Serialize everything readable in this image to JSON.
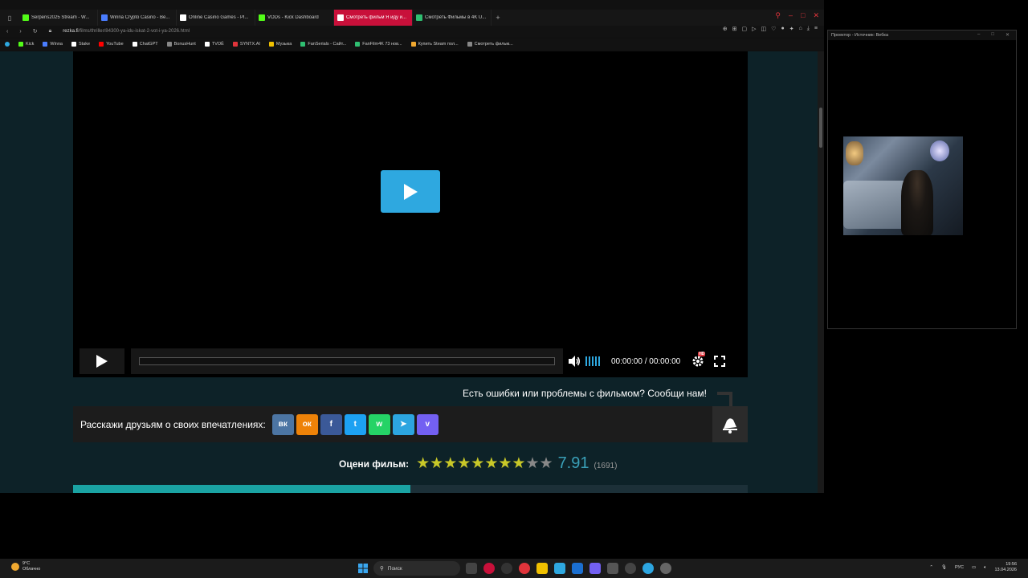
{
  "browser": {
    "tabs": [
      {
        "label": "Serpens2025 Stream - W...",
        "icon": "kick-icon",
        "color": "#53fc18"
      },
      {
        "label": "Winna Crypto Casino - Be...",
        "icon": "winna-icon",
        "color": "#4a7dff"
      },
      {
        "label": "Online Casino Games - Pl...",
        "icon": "stake-icon",
        "color": "#ffffff"
      },
      {
        "label": "VODs - Kick Dashboard",
        "icon": "kick-icon",
        "color": "#53fc18"
      },
      {
        "label": "Смотреть фильм Я иду и...",
        "icon": "hd-icon",
        "color": "#ffffff"
      },
      {
        "label": "Смотреть Фильмы в 4K U...",
        "icon": "fanfilm-icon",
        "color": "#2fbf71"
      }
    ],
    "url_host": "rezka.fi",
    "url_path": "/films/thriller/84300-ya-idu-iskat-2-vot-i-ya-2026.html",
    "bookmarks": [
      {
        "label": "Kick",
        "color": "#53fc18"
      },
      {
        "label": "Winna",
        "color": "#4a7dff"
      },
      {
        "label": "Stake",
        "color": "#ffffff"
      },
      {
        "label": "YouTube",
        "color": "#ff0000"
      },
      {
        "label": "ChatGPT",
        "color": "#ffffff"
      },
      {
        "label": "BonusHunt",
        "color": "#888888"
      },
      {
        "label": "TVOЁ",
        "color": "#ffffff"
      },
      {
        "label": "SYNTX.AI",
        "color": "#e0343b"
      },
      {
        "label": "Музыка",
        "color": "#f0c000"
      },
      {
        "label": "FanSerials - Сайт...",
        "color": "#2fbf71"
      },
      {
        "label": "FanFilm4K 73 нов...",
        "color": "#2fbf71"
      },
      {
        "label": "Купить Steam пол...",
        "color": "#f0a830"
      },
      {
        "label": "Смотреть фильм...",
        "color": "#888888"
      }
    ]
  },
  "player": {
    "time": "00:00:00 / 00:00:00",
    "hd_badge": "HD",
    "progress": 0
  },
  "report_text": "Есть ошибки или проблемы с фильмом? Сообщи нам!",
  "share": {
    "label": "Расскажи друзьям о своих впечатлениях:",
    "buttons": [
      {
        "name": "vk",
        "glyph": "вк",
        "color": "#4c75a3"
      },
      {
        "name": "odnoklassniki",
        "glyph": "ок",
        "color": "#ee8208"
      },
      {
        "name": "facebook",
        "glyph": "f",
        "color": "#3b5998"
      },
      {
        "name": "twitter",
        "glyph": "t",
        "color": "#1da1f2"
      },
      {
        "name": "whatsapp",
        "glyph": "w",
        "color": "#25d366"
      },
      {
        "name": "telegram",
        "glyph": "➤",
        "color": "#2ca5e0"
      },
      {
        "name": "viber",
        "glyph": "v",
        "color": "#7360f2"
      }
    ]
  },
  "rating": {
    "label": "Оцени фильм:",
    "score": "7.91",
    "votes": "(1691)",
    "stars_total": 10,
    "stars_filled": 8,
    "star_color": "#c8c828",
    "star_empty_color": "#888888"
  },
  "projector": {
    "title": "Проектор - Источник: Вебка"
  },
  "taskbar": {
    "weather_temp": "9°C",
    "weather_desc": "Облачно",
    "search_placeholder": "Поиск",
    "lang": "РУС",
    "time": "19:56",
    "date": "13.04.2026"
  }
}
